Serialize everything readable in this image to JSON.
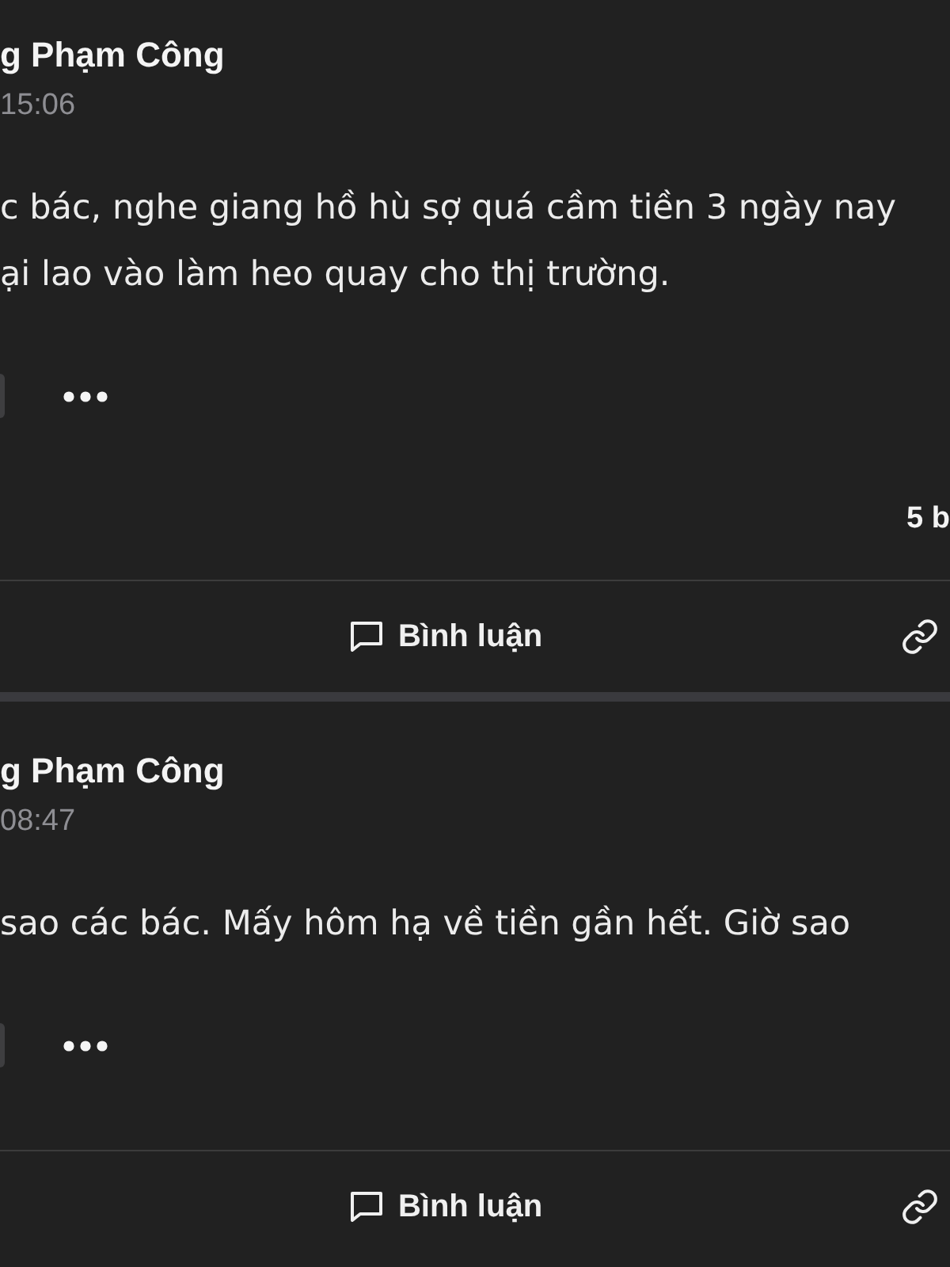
{
  "posts": [
    {
      "author": "g Phạm Công",
      "time": "15:06",
      "body_lines": [
        "c bác, nghe giang hồ hù sợ quá cầm tiền 3 ngày nay",
        "ại lao vào làm heo quay cho thị trường."
      ],
      "comment_count": "5 b",
      "actions": [
        {
          "kind": "comment",
          "label": "Bình luận"
        },
        {
          "kind": "link"
        }
      ]
    },
    {
      "author": "g Phạm Công",
      "time": "08:47",
      "body_lines": [
        "sao các bác. Mấy hôm hạ về tiền gần hết. Giờ sao"
      ],
      "actions": [
        {
          "kind": "comment",
          "label": "Bình luận"
        },
        {
          "kind": "link"
        }
      ]
    }
  ]
}
